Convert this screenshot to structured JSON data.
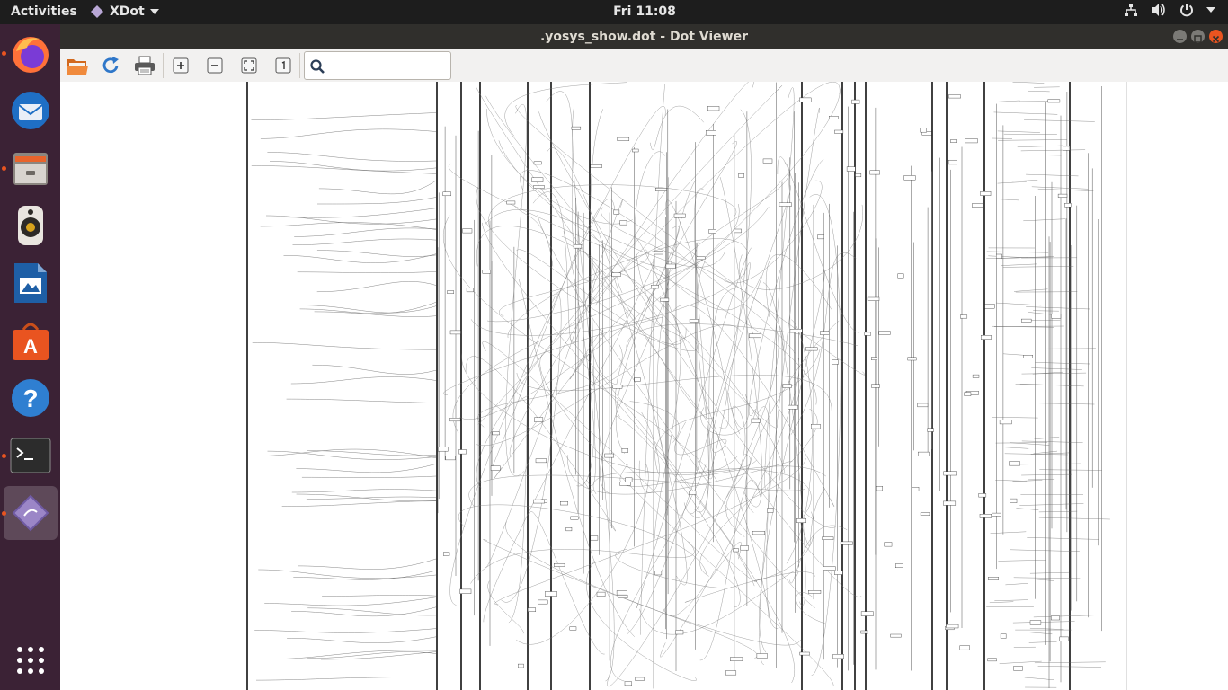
{
  "topbar": {
    "activities": "Activities",
    "app_name": "XDot",
    "clock": "Fri 11:08"
  },
  "window": {
    "title": ".yosys_show.dot - Dot Viewer"
  },
  "toolbar": {
    "buttons": [
      "open-icon",
      "reload-icon",
      "print-icon",
      "zoom-in-icon",
      "zoom-out-icon",
      "zoom-fit-icon",
      "zoom-100-icon"
    ],
    "search": {
      "value": "",
      "placeholder": ""
    }
  },
  "dock": {
    "items": [
      "firefox-icon",
      "thunderbird-icon",
      "files-icon",
      "rhythmbox-icon",
      "writer-icon",
      "software-icon",
      "help-icon",
      "terminal-icon",
      "xdot-icon",
      "app-grid-icon"
    ]
  },
  "colors": {
    "accent": "#e95420",
    "dock_bg": "#3b2235",
    "topbar_bg": "#1d1d1d",
    "titlebar_bg": "#302f2c"
  }
}
